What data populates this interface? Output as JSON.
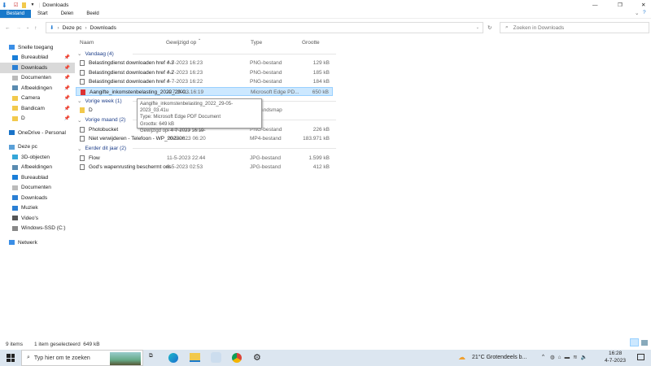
{
  "window": {
    "title": "Downloads",
    "tabs": [
      "Bestand",
      "Start",
      "Delen",
      "Beeld"
    ]
  },
  "address": {
    "crumbs": [
      "Deze pc",
      "Downloads"
    ],
    "search_placeholder": "Zoeken in Downloads"
  },
  "sidebar": {
    "items": [
      {
        "label": "Snelle toegang",
        "top": true,
        "icon": "star-icon",
        "color": "#3a8ee6"
      },
      {
        "label": "Bureaublad",
        "icon": "desktop-icon",
        "color": "#1a7ed8",
        "pin": true
      },
      {
        "label": "Downloads",
        "icon": "download-icon",
        "color": "#2a7fd4",
        "pin": true,
        "selected": true
      },
      {
        "label": "Documenten",
        "icon": "document-icon",
        "color": "#bbb",
        "pin": true
      },
      {
        "label": "Afbeeldingen",
        "icon": "pictures-icon",
        "color": "#5a8bb0",
        "pin": true
      },
      {
        "label": "Camera",
        "icon": "folder-icon",
        "color": "#f2c94c",
        "pin": true
      },
      {
        "label": "Bandicam",
        "icon": "folder-icon",
        "color": "#f2c94c",
        "pin": true
      },
      {
        "label": "D",
        "icon": "folder-icon",
        "color": "#f2c94c",
        "pin": true
      },
      {
        "label": "OneDrive - Personal",
        "top": true,
        "icon": "cloud-icon",
        "color": "#1a73c8",
        "gap": true
      },
      {
        "label": "Deze pc",
        "top": true,
        "icon": "computer-icon",
        "color": "#5aa0d8",
        "gap": true
      },
      {
        "label": "3D-objecten",
        "icon": "cube-icon",
        "color": "#35a6d8"
      },
      {
        "label": "Afbeeldingen",
        "icon": "pictures-icon",
        "color": "#5a8bb0"
      },
      {
        "label": "Bureaublad",
        "icon": "desktop-icon",
        "color": "#1a7ed8"
      },
      {
        "label": "Documenten",
        "icon": "document-icon",
        "color": "#bbb"
      },
      {
        "label": "Downloads",
        "icon": "download-icon",
        "color": "#2a7fd4"
      },
      {
        "label": "Muziek",
        "icon": "music-icon",
        "color": "#2a7fd4"
      },
      {
        "label": "Video's",
        "icon": "video-icon",
        "color": "#555"
      },
      {
        "label": "Windows-SSD (C:)",
        "icon": "drive-icon",
        "color": "#888"
      },
      {
        "label": "Netwerk",
        "top": true,
        "icon": "network-icon",
        "color": "#3a8ee6",
        "gap": true
      }
    ]
  },
  "columns": [
    "Naam",
    "Gewijzigd op",
    "Type",
    "Grootte"
  ],
  "groups": [
    {
      "label": "Vandaag (4)",
      "files": [
        {
          "name": "Belastingdienst downloaden href #.3",
          "date": "4-7-2023 16:23",
          "type": "PNG-bestand",
          "size": "129 kB"
        },
        {
          "name": "Belastingdienst downloaden href #.2",
          "date": "4-7-2023 16:23",
          "type": "PNG-bestand",
          "size": "185 kB"
        },
        {
          "name": "Belastingdienst downloaden href #",
          "date": "4-7-2023 16:22",
          "type": "PNG-bestand",
          "size": "184 kB"
        },
        {
          "name": "Aangifte_inkomstenbelasting_2022_29-0...",
          "date": "4-7-2023 16:19",
          "type": "Microsoft Edge PD...",
          "size": "650 kB",
          "selected": true,
          "pdf": true
        }
      ]
    },
    {
      "label": "Vorige week (1)",
      "files": [
        {
          "name": "D",
          "date": "",
          "type": "Bestandsmap",
          "size": "",
          "folder": true
        }
      ]
    },
    {
      "label": "Vorige maand (2)",
      "files": [
        {
          "name": "Photobucket",
          "date": "13-6-2023 00:22",
          "type": "PNG-bestand",
          "size": "226 kB"
        },
        {
          "name": "Niet verwijderen - Telefoon - WP_202306...",
          "date": "10-6-2023 06:20",
          "type": "MP4-bestand",
          "size": "183.971 kB"
        }
      ]
    },
    {
      "label": "Eerder dit jaar (2)",
      "files": [
        {
          "name": "Flow",
          "date": "11-5-2023 22:44",
          "type": "JPG-bestand",
          "size": "1.599 kB"
        },
        {
          "name": "God's wapenrusting beschermt ons",
          "date": "8-5-2023 02:53",
          "type": "JPG-bestand",
          "size": "412 kB"
        }
      ]
    }
  ],
  "tooltip": [
    "Aangifte_inkomstenbelasting_2022_29-05-2023_03.41u",
    "Type: Microsoft Edge PDF Document",
    "Grootte: 649 kB",
    "Gewijzigd op: 4-7-2023 16:19"
  ],
  "status": {
    "count": "9 items",
    "selection": "1 item geselecteerd  649 kB"
  },
  "taskbar": {
    "search": "Typ hier om te zoeken",
    "weather": "21°C  Grotendeels b...",
    "time": "16:28",
    "date": "4-7-2023"
  }
}
